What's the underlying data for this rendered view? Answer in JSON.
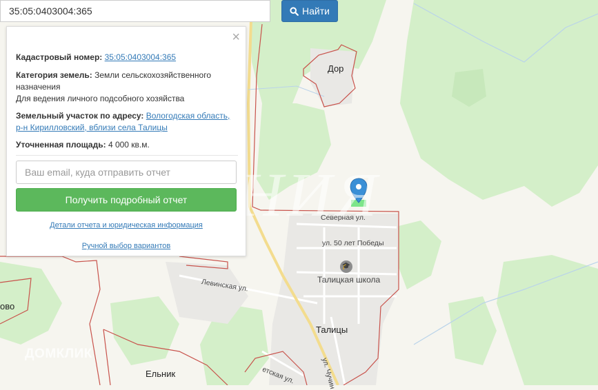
{
  "search": {
    "value": "35:05:0403004:365",
    "button_label": "Найти",
    "icon": "search-icon"
  },
  "panel": {
    "close_label": "×",
    "cadastral_label": "Кадастровый номер:",
    "cadastral_value": "35:05:0403004:365",
    "category_label": "Категория земель:",
    "category_value_1": "Земли сельскохозяйственного",
    "category_value_2": "назначения",
    "usage_value": "Для ведения личного подсобного хозяйства",
    "address_label": "Земельный участок по адресу:",
    "address_value_1": "Вологодская область,",
    "address_value_2": "р-н Кирилловский, вблизи села Талицы",
    "area_label": "Уточненная площадь:",
    "area_value": "4 000 кв.м.",
    "email_placeholder": "Ваш email, куда отправить отчет",
    "report_button": "Получить подробный отчет",
    "details_link": "Детали отчета и юридическая информация",
    "manual_link": "Ручной выбор вариантов"
  },
  "map": {
    "labels": {
      "dor": "Дор",
      "severnaya": "Северная ул.",
      "pobedy": "ул. 50 лет Победы",
      "school": "Талицкая школа",
      "levinskaya": "Левинская ул.",
      "talitsy": "Талицы",
      "elnik": "Ельник",
      "ovo": "ово",
      "chuchin": "ул. Чучин",
      "sovetskaya": "етская ул."
    },
    "watermark": "ИМ   НИЯ",
    "logo": "ДОМКЛИК",
    "colors": {
      "forest": "#d4efc9",
      "boundary": "#c8524b",
      "road": "#f3dc8e",
      "settlement": "#e9e8e5",
      "accent": "#337ab7",
      "success": "#5cb85c",
      "marker": "#3a8fd6"
    },
    "marker_icon": "map-pin-icon",
    "school_icon": "graduation-cap-icon"
  }
}
